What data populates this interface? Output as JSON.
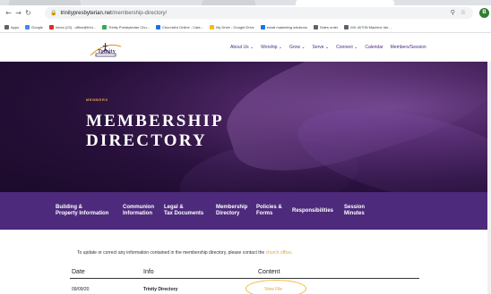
{
  "browser": {
    "url_domain": "trinitypresbyterian.net",
    "url_path": "/membership-directory/",
    "lock_icon": "lock-icon",
    "profile_initial": "B",
    "bookmarks": [
      {
        "label": "Apps",
        "color": "#5f6368"
      },
      {
        "label": "Google",
        "color": "#4285f4"
      },
      {
        "label": "Inbox (23) - office@trini...",
        "color": "#d93025"
      },
      {
        "label": "Trinity Presbyterian Chu...",
        "color": "#34a853"
      },
      {
        "label": "ChurchArt Online - Cate...",
        "color": "#1a73e8"
      },
      {
        "label": "My Drive - Google Drive",
        "color": "#fbbc04"
      },
      {
        "label": "email marketing solutions",
        "color": "#1a73e8"
      },
      {
        "label": "Sales order",
        "color": "#5f6368"
      },
      {
        "label": "MX-4070N Machine Ide...",
        "color": "#5f6368"
      }
    ]
  },
  "site": {
    "logo_text": "Trinity",
    "nav": [
      "About Us ⌄",
      "Worship ⌄",
      "Grow ⌄",
      "Serve ⌄",
      "Connect ⌄",
      "Calendar",
      "Members/Session"
    ]
  },
  "hero": {
    "kicker": "MEMBERS",
    "title_line1": "MEMBERSHIP",
    "title_line2": "DIRECTORY"
  },
  "subnav": [
    "Building &\nProperty Information",
    "Communion\nInformation",
    "Legal &\nTax Documents",
    "Membership\nDirectory",
    "Policies &\nForms",
    "Responsibilities",
    "Session\nMinutes"
  ],
  "content": {
    "notice_prefix": "To update or correct any information contained in the membership directory, please contact the ",
    "notice_link": "church office",
    "notice_suffix": ".",
    "headers": {
      "date": "Date",
      "info": "Info",
      "content": "Content"
    },
    "rows": [
      {
        "date": "09/09/20",
        "info": "Trinity Directory",
        "content": "View File"
      }
    ]
  },
  "colors": {
    "brand_purple": "#4d2a7c",
    "accent_gold": "#e0a24a"
  }
}
